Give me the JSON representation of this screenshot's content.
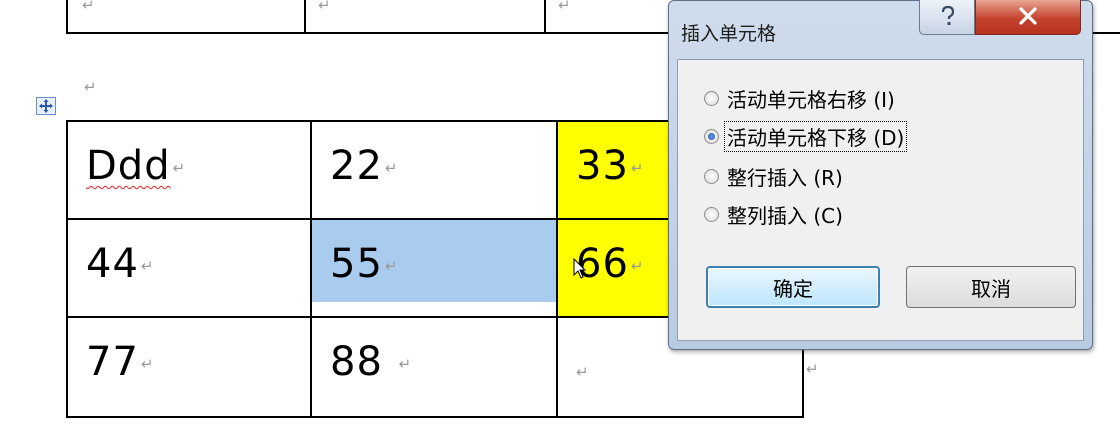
{
  "paragraph_mark": "↵",
  "top_table": {
    "cells": [
      "↵",
      "↵",
      "↵"
    ]
  },
  "table": {
    "rows": [
      [
        {
          "text": "Ddd"
        },
        {
          "text": "22"
        },
        {
          "text": "33",
          "highlight": "#ffff00"
        }
      ],
      [
        {
          "text": "44"
        },
        {
          "text": "55",
          "highlight": "#a8cbee"
        },
        {
          "text": "66",
          "highlight": "#ffff00"
        }
      ],
      [
        {
          "text": "77"
        },
        {
          "text": "88 "
        },
        {
          "text": ""
        }
      ]
    ]
  },
  "dialog": {
    "title": "插入单元格",
    "options": [
      {
        "label": "活动单元格右移 (I)",
        "checked": false
      },
      {
        "label": "活动单元格下移 (D)",
        "checked": true
      },
      {
        "label": "整行插入 (R)",
        "checked": false
      },
      {
        "label": "整列插入 (C)",
        "checked": false
      }
    ],
    "ok_label": "确定",
    "cancel_label": "取消"
  },
  "colors": {
    "yellow": "#ffff00",
    "selection": "#a8cbee",
    "title_bar": "#cfdcec",
    "close": "#c4432e"
  }
}
